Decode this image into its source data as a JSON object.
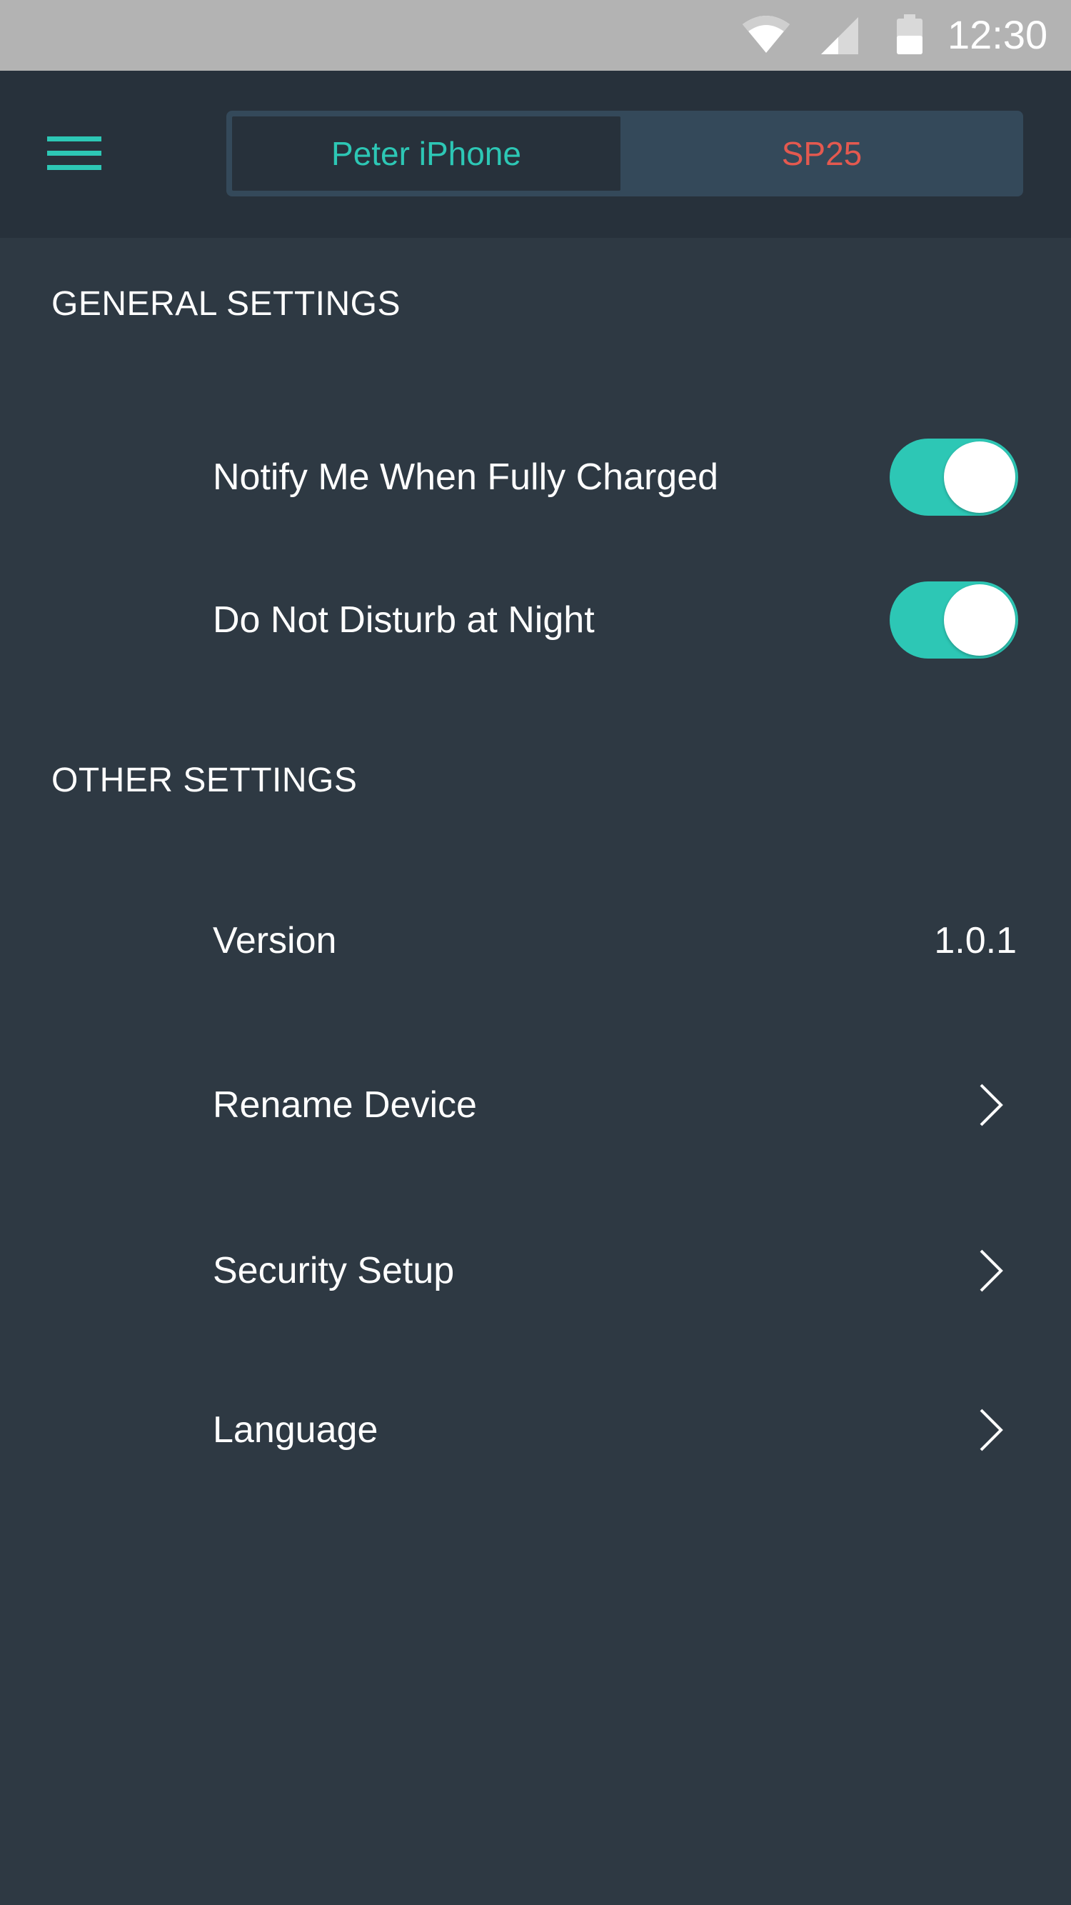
{
  "status_bar": {
    "time": "12:30",
    "icons": [
      "wifi-icon",
      "signal-icon",
      "battery-icon"
    ]
  },
  "header": {
    "menu_icon": "hamburger-menu-icon",
    "tabs": [
      {
        "label": "Peter iPhone",
        "active": true,
        "color": "#2dc7b5"
      },
      {
        "label": "SP25",
        "active": false,
        "color": "#e4594f"
      }
    ]
  },
  "general_settings": {
    "title": "GENERAL SETTINGS",
    "items": [
      {
        "label": "Notify Me When Fully Charged",
        "toggle": true
      },
      {
        "label": "Do Not Disturb at Night",
        "toggle": true
      }
    ]
  },
  "other_settings": {
    "title": "OTHER SETTINGS",
    "items": [
      {
        "label": "Version",
        "value": "1.0.1"
      },
      {
        "label": "Rename Device",
        "icon": "chevron-right-icon"
      },
      {
        "label": "Security Setup",
        "icon": "chevron-right-icon"
      },
      {
        "label": "Language",
        "icon": "chevron-right-icon"
      }
    ]
  },
  "colors": {
    "accent": "#2dc7b5",
    "alert": "#e4594f",
    "background": "#2e3943",
    "header": "#27313b"
  }
}
